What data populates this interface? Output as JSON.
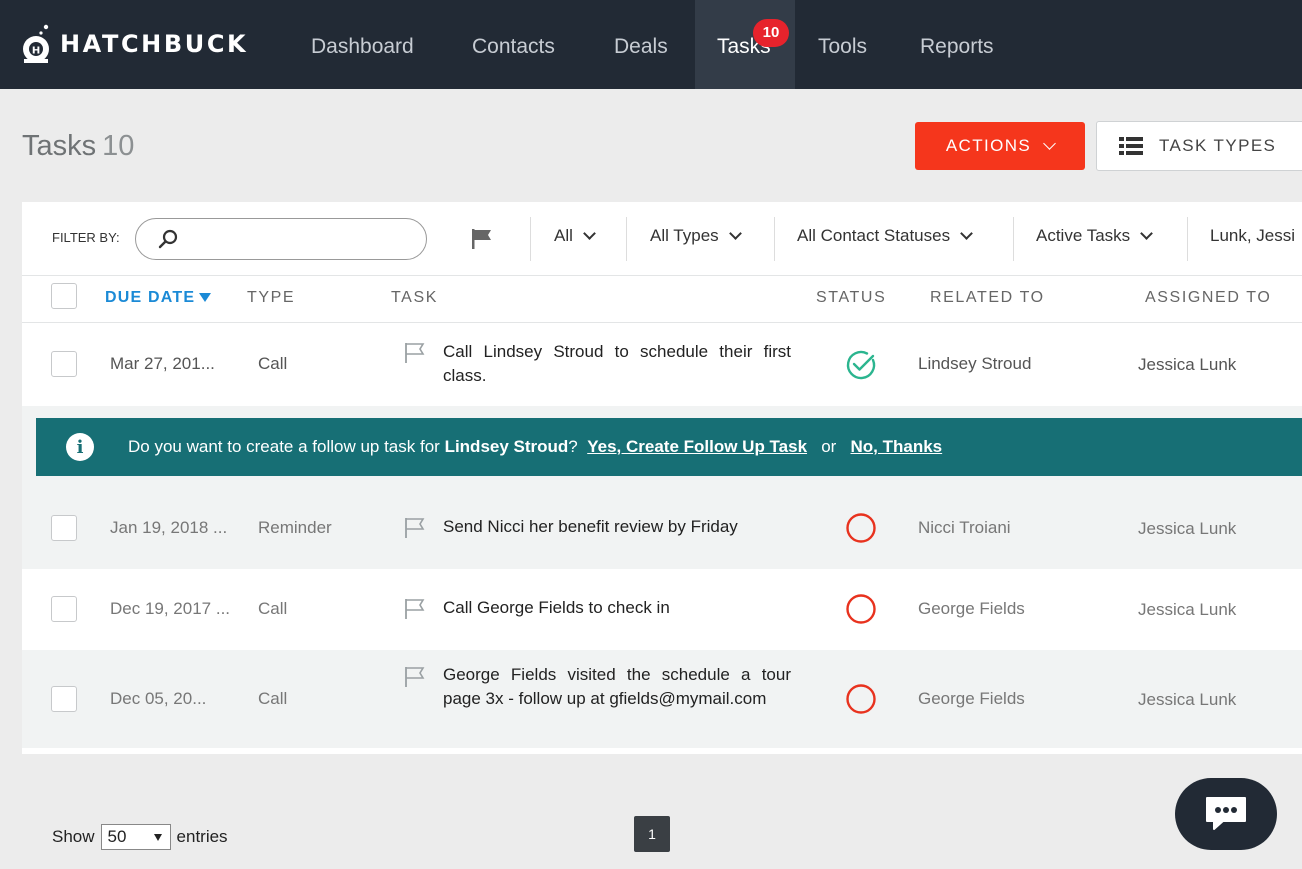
{
  "app": {
    "logo_text": "HATCHBUCK"
  },
  "nav": {
    "items": [
      {
        "label": "Dashboard"
      },
      {
        "label": "Contacts"
      },
      {
        "label": "Deals"
      },
      {
        "label": "Tasks",
        "badge": "10"
      },
      {
        "label": "Tools"
      },
      {
        "label": "Reports"
      }
    ],
    "active": "Tasks"
  },
  "page": {
    "title": "Tasks",
    "count": "10",
    "actions_label": "ACTIONS",
    "task_types_label": "TASK TYPES"
  },
  "filters": {
    "label": "FILTER BY:",
    "search_placeholder": "",
    "dropdowns": [
      {
        "label": "All"
      },
      {
        "label": "All Types"
      },
      {
        "label": "All Contact Statuses"
      },
      {
        "label": "Active Tasks"
      },
      {
        "label": "Lunk, Jessi"
      }
    ]
  },
  "table": {
    "columns": {
      "due_date": "DUE DATE",
      "type": "TYPE",
      "task": "TASK",
      "status": "STATUS",
      "related_to": "RELATED TO",
      "assigned_to": "ASSIGNED TO"
    },
    "sort": {
      "column": "due_date",
      "direction": "desc"
    },
    "rows": [
      {
        "due_date": "Mar 27, 201...",
        "type": "Call",
        "task": "Call Lindsey Stroud to schedule their first class.",
        "status": "complete",
        "related_to": "Lindsey Stroud",
        "assigned_to": "Jessica Lunk"
      },
      {
        "due_date": "Jan 19, 2018 ...",
        "type": "Reminder",
        "task": "Send Nicci her benefit review by Friday",
        "status": "open",
        "related_to": "Nicci Troiani",
        "assigned_to": "Jessica Lunk"
      },
      {
        "due_date": "Dec 19, 2017 ...",
        "type": "Call",
        "task": "Call George Fields to check in",
        "status": "open",
        "related_to": "George Fields",
        "assigned_to": "Jessica Lunk"
      },
      {
        "due_date": "Dec 05, 20...",
        "type": "Call",
        "task": "George Fields visited the schedule a tour page 3x - follow up at gfields@mymail.com",
        "status": "open",
        "related_to": "George Fields",
        "assigned_to": "Jessica Lunk"
      }
    ]
  },
  "followup": {
    "prefix": "Do you want to create a follow up task for",
    "contact": "Lindsey Stroud",
    "question_mark": "?",
    "yes_label": "Yes, Create Follow Up Task",
    "or_label": "or",
    "no_label": "No, Thanks"
  },
  "footer": {
    "show_label": "Show",
    "page_size": "50",
    "entries_label": "entries",
    "current_page": "1"
  },
  "colors": {
    "nav_bg": "#222a35",
    "accent_orange": "#f5361c",
    "followup_bg": "#176f75",
    "status_complete": "#2bb58f",
    "status_open": "#e8321e",
    "sort_blue": "#1b8ad6"
  },
  "icons": {
    "logo": "diver-helmet-icon",
    "search": "search-icon",
    "flag_filter": "flag-icon",
    "task_flag": "flag-outline-icon",
    "status_complete": "check-circle-icon",
    "status_open": "empty-circle-icon",
    "info": "info-icon",
    "chat": "chat-bubble-icon",
    "task_types": "list-icon"
  }
}
